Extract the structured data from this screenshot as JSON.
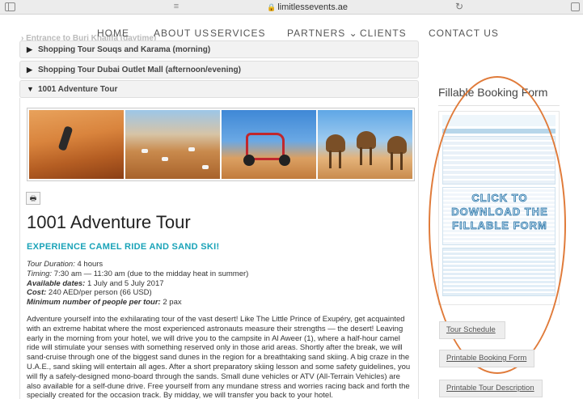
{
  "browser": {
    "url": "limitlessevents.ae",
    "sidebar_icon": "sidebar-icon",
    "reader_icon": "reader-icon",
    "lock_icon": "lock-icon",
    "reload_icon": "reload-icon"
  },
  "nav": {
    "items": [
      "HOME",
      "ABOUT US",
      "SERVICES",
      "PARTNERS ⌄",
      "CLIENTS",
      "CONTACT US"
    ],
    "ghost_text": "Entrance to Burj Khalifa (daytime)"
  },
  "accordion": {
    "items": [
      "Shopping Tour Souqs and Karama (morning)",
      "Shopping Tour Dubai Outlet Mall (afternoon/evening)",
      "1001 Adventure Tour"
    ]
  },
  "tour": {
    "title": "1001 Adventure Tour",
    "subtitle": "EXPERIENCE CAMEL RIDE AND SAND SKI!",
    "duration_label": "Tour Duration:",
    "duration_value": " 4 hours",
    "timing_label": "Timing:",
    "timing_value": " 7:30 am — 11:30 am (due to the midday heat in summer)",
    "dates_label": "Available dates:",
    "dates_value": " 1 July and 5 July 2017",
    "cost_label": "Cost:",
    "cost_value": " 240 AED/per person (66 USD)",
    "min_label": "Minimum number of people per tour:",
    "min_value": " 2 pax",
    "body": "Adventure yourself into the exhilarating tour of the vast desert! Like The Little Prince of Exupéry, get acquainted with an extreme habitat where the most experienced astronauts measure their strengths — the desert! Leaving early in the morning from your hotel, we will drive you to the campsite in Al Aweer (1), where a half-hour camel ride will stimulate your senses with something reserved only in those arid areas. Shortly after the break, we will sand-cruise through one of the biggest sand dunes in the region for a breathtaking sand skiing. A big craze in the U.A.E., sand skiing will entertain all ages. After a short preparatory skiing lesson and some safety guidelines, you will fly a safely-designed mono-board through the sands. Small dune vehicles or ATV (All-Terrain Vehicles) are also available for a self-dune drive. Free yourself from any mundane stress and worries racing back and forth the specially created for the occasion track. By midday, we will transfer you back to your hotel."
  },
  "sidebar": {
    "title": "Fillable Booking Form",
    "overlay_text": "CLICK TO DOWNLOAD THE FILLABLE FORM",
    "buttons": [
      "Tour Schedule",
      "Printable Booking Form",
      "Printable Tour Description"
    ]
  },
  "colors": {
    "accent": "#1aa3b8",
    "highlight_oval": "#e07b3a"
  }
}
